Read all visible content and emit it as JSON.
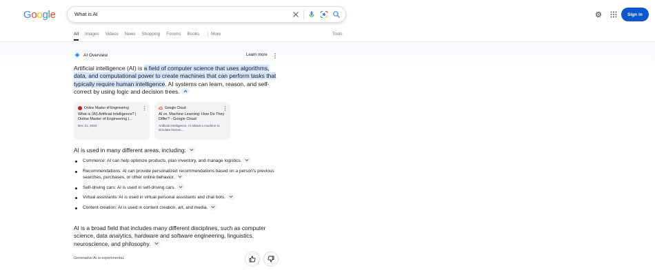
{
  "logo": {
    "text": "Google",
    "letters": [
      "G",
      "o",
      "o",
      "g",
      "l",
      "e"
    ],
    "colors": [
      "#4285F4",
      "#EA4335",
      "#FBBC05",
      "#4285F4",
      "#34A853",
      "#EA4335"
    ]
  },
  "search": {
    "query": "What is AI"
  },
  "header": {
    "sign_in": "Sign in"
  },
  "tabs": [
    "All",
    "Images",
    "Videos",
    "News",
    "Shopping",
    "Forums",
    "Books",
    "⋮ More"
  ],
  "tools": "Tools",
  "ai_overview": {
    "title": "AI Overview",
    "learn_more": "Learn more",
    "intro_plain": "Artificial intelligence (AI) is ",
    "intro_highlight": "a field of computer science that uses algorithms, data, and computational power to create machines that can perform tasks that typically require human intelligence",
    "intro_rest": ". AI systems can learn, reason, and self-correct by using logic and decision trees.",
    "sources": [
      {
        "site": "Online Master of Engineering",
        "title": "What is (AI) Artificial Intelligence? | Online Master of Engineering |...",
        "sub": "Dec 21, 2023"
      },
      {
        "site": "Google Cloud",
        "title": "AI vs. Machine Learning: How Do They Differ? - Google Cloud",
        "sub": "Artificial intelligence. AI allows a machine to simulate human..."
      }
    ],
    "list_heading": "AI is used in many different areas, including:",
    "list": [
      "Commerce: AI can help optimize products, plan inventory, and manage logistics.",
      "Recommendations: AI can provide personalized recommendations based on a person's previous searches, purchases, or other online behavior.",
      "Self-driving cars: AI is used in self-driving cars.",
      "Virtual assistants: AI is used in virtual personal assistants and chat bots.",
      "Content creation: AI is used in content creation, art, and media."
    ],
    "closing": "AI is a broad field that includes many different disciplines, such as computer science, data analytics, hardware and software engineering, linguistics, neuroscience, and philosophy.",
    "footer_note": "Generative AI is experimental."
  },
  "colors": {
    "accent": "#0b57d0",
    "highlight": "#d3e3fd"
  }
}
